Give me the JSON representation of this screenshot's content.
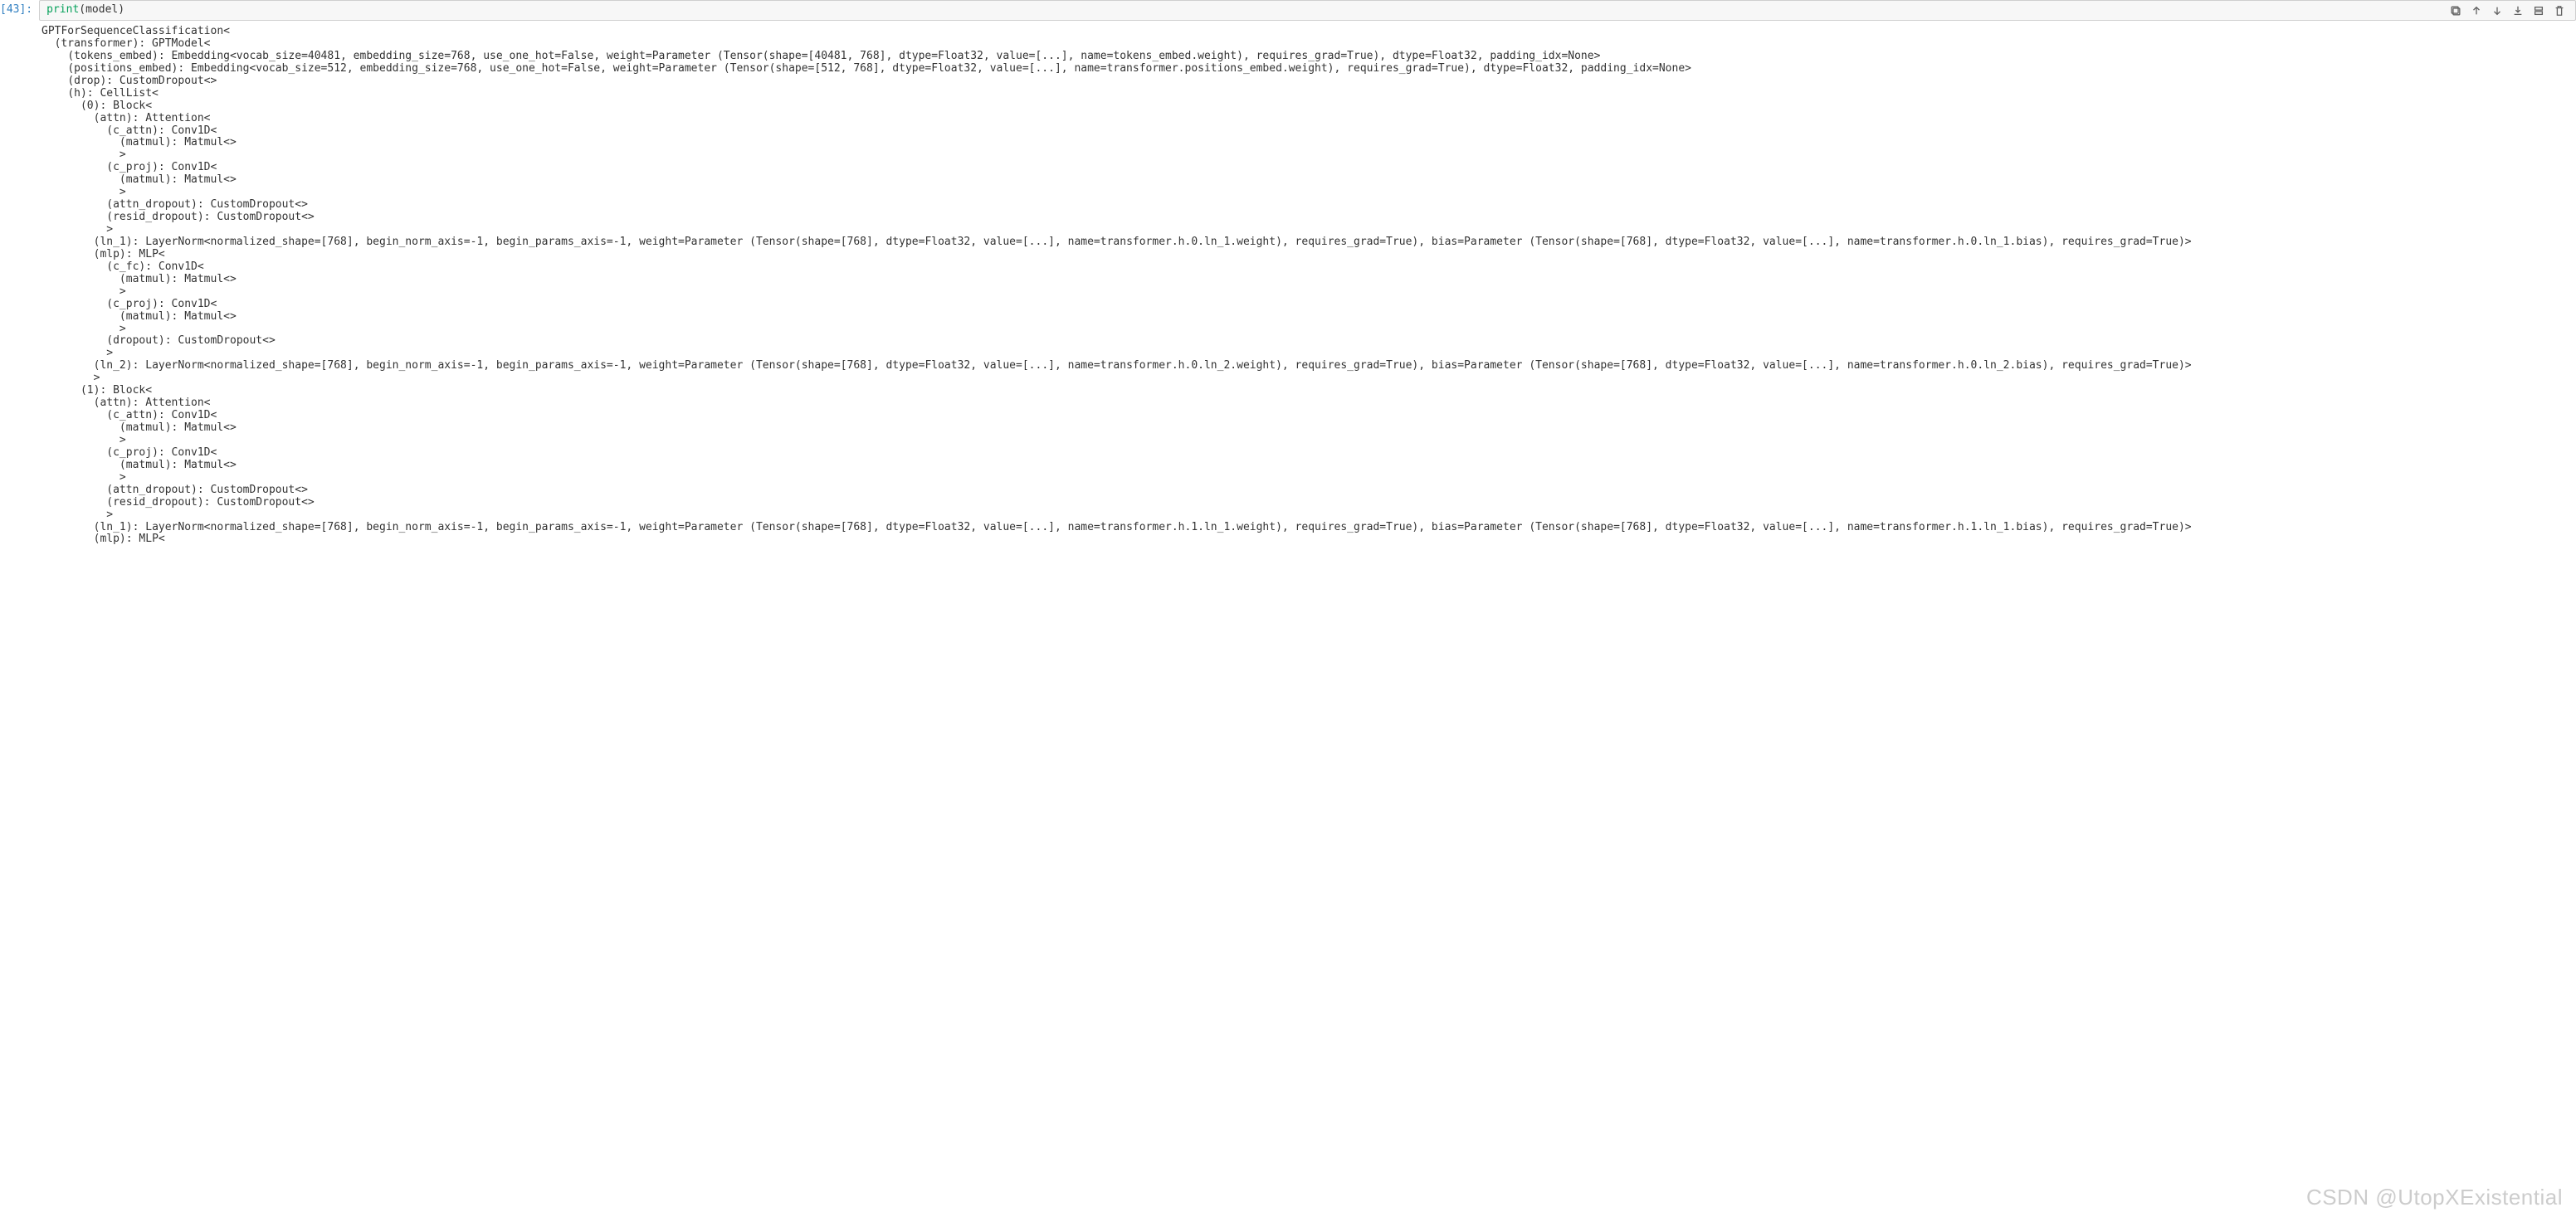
{
  "cell": {
    "prompt": "[43]:",
    "code_func": "print",
    "code_args": "(model)"
  },
  "toolbar": {
    "copy_title": "Copy",
    "up_title": "Move up",
    "down_title": "Move down",
    "download_title": "Download",
    "insert_title": "Insert below",
    "delete_title": "Delete"
  },
  "output_text": "GPTForSequenceClassification<\n  (transformer): GPTModel<\n    (tokens_embed): Embedding<vocab_size=40481, embedding_size=768, use_one_hot=False, weight=Parameter (Tensor(shape=[40481, 768], dtype=Float32, value=[...], name=tokens_embed.weight), requires_grad=True), dtype=Float32, padding_idx=None>\n    (positions_embed): Embedding<vocab_size=512, embedding_size=768, use_one_hot=False, weight=Parameter (Tensor(shape=[512, 768], dtype=Float32, value=[...], name=transformer.positions_embed.weight), requires_grad=True), dtype=Float32, padding_idx=None>\n    (drop): CustomDropout<>\n    (h): CellList<\n      (0): Block<\n        (attn): Attention<\n          (c_attn): Conv1D<\n            (matmul): Matmul<>\n            >\n          (c_proj): Conv1D<\n            (matmul): Matmul<>\n            >\n          (attn_dropout): CustomDropout<>\n          (resid_dropout): CustomDropout<>\n          >\n        (ln_1): LayerNorm<normalized_shape=[768], begin_norm_axis=-1, begin_params_axis=-1, weight=Parameter (Tensor(shape=[768], dtype=Float32, value=[...], name=transformer.h.0.ln_1.weight), requires_grad=True), bias=Parameter (Tensor(shape=[768], dtype=Float32, value=[...], name=transformer.h.0.ln_1.bias), requires_grad=True)>\n        (mlp): MLP<\n          (c_fc): Conv1D<\n            (matmul): Matmul<>\n            >\n          (c_proj): Conv1D<\n            (matmul): Matmul<>\n            >\n          (dropout): CustomDropout<>\n          >\n        (ln_2): LayerNorm<normalized_shape=[768], begin_norm_axis=-1, begin_params_axis=-1, weight=Parameter (Tensor(shape=[768], dtype=Float32, value=[...], name=transformer.h.0.ln_2.weight), requires_grad=True), bias=Parameter (Tensor(shape=[768], dtype=Float32, value=[...], name=transformer.h.0.ln_2.bias), requires_grad=True)>\n        >\n      (1): Block<\n        (attn): Attention<\n          (c_attn): Conv1D<\n            (matmul): Matmul<>\n            >\n          (c_proj): Conv1D<\n            (matmul): Matmul<>\n            >\n          (attn_dropout): CustomDropout<>\n          (resid_dropout): CustomDropout<>\n          >\n        (ln_1): LayerNorm<normalized_shape=[768], begin_norm_axis=-1, begin_params_axis=-1, weight=Parameter (Tensor(shape=[768], dtype=Float32, value=[...], name=transformer.h.1.ln_1.weight), requires_grad=True), bias=Parameter (Tensor(shape=[768], dtype=Float32, value=[...], name=transformer.h.1.ln_1.bias), requires_grad=True)>\n        (mlp): MLP<",
  "watermark": "CSDN @UtopXExistential"
}
